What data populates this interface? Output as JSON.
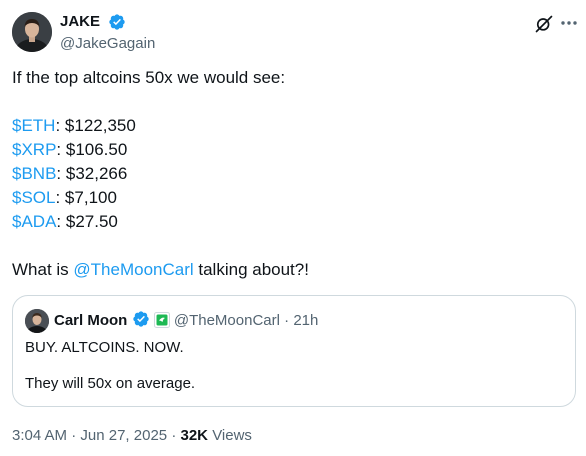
{
  "author": {
    "display_name": "JAKE",
    "handle": "@JakeGagain"
  },
  "tweet": {
    "intro": "If the top altcoins 50x we would see:",
    "prices": [
      {
        "ticker": "$ETH",
        "value": ": $122,350"
      },
      {
        "ticker": "$XRP",
        "value": ": $106.50"
      },
      {
        "ticker": "$BNB",
        "value": ": $32,266"
      },
      {
        "ticker": "$SOL",
        "value": ": $7,100"
      },
      {
        "ticker": "$ADA",
        "value": ": $27.50"
      }
    ],
    "question_before": "What is ",
    "question_mention": "@TheMoonCarl",
    "question_after": " talking about?!"
  },
  "quote": {
    "display_name": "Carl Moon",
    "handle": "@TheMoonCarl",
    "separator": "·",
    "time": "21h",
    "line1": "BUY. ALTCOINS. NOW.",
    "line2": "They will 50x on average."
  },
  "meta": {
    "time": "3:04 AM",
    "sep1": "·",
    "date": "Jun 27, 2025",
    "sep2": "·",
    "views_count": "32K",
    "views_label": "Views"
  },
  "colors": {
    "link": "#1d9bf0",
    "verified": "#1d9bf0",
    "muted": "#536471",
    "border": "#cfd9de"
  },
  "icons": [
    "verified-badge-icon",
    "grok-icon",
    "more-options-icon",
    "affiliate-badge-icon"
  ]
}
